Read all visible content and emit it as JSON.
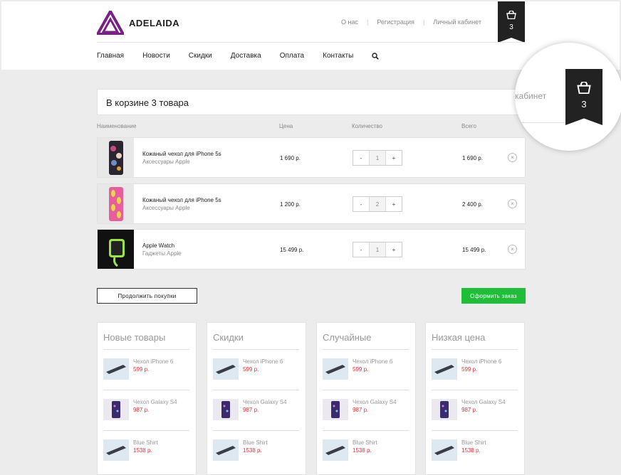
{
  "header": {
    "brand": "ADELAIDA",
    "top_links": [
      "О нас",
      "Регистрация",
      "Личный кабинет"
    ],
    "cart_count": "3",
    "nav": [
      "Главная",
      "Новости",
      "Скидки",
      "Доставка",
      "Оплата",
      "Контакты"
    ]
  },
  "cart": {
    "title": "В корзине 3 товара",
    "columns": {
      "name": "Наименование",
      "price": "Цена",
      "qty": "Количество",
      "total": "Всего"
    },
    "items": [
      {
        "name": "Кожаный чехол для iPhone 5s",
        "category": "Аксессуары Apple",
        "price": "1 690 р.",
        "qty": "1",
        "total": "1 690 р.",
        "thumb": "phone-case-dark"
      },
      {
        "name": "Кожаный чехол для iPhone 5s",
        "category": "Аксессуары Apple",
        "price": "1 200 р.",
        "qty": "2",
        "total": "2 400 р.",
        "thumb": "phone-case-pink"
      },
      {
        "name": "Apple Watch",
        "category": "Гаджеты Apple",
        "price": "15 499 р.",
        "qty": "1",
        "total": "15 499 р.",
        "thumb": "watch-green"
      }
    ],
    "minus": "-",
    "plus": "+",
    "continue_label": "Продолжить покупки",
    "order_label": "Оформить заказ",
    "accent_color": "#1fbd3a"
  },
  "panels": [
    {
      "title": "Новые товары",
      "items": [
        {
          "name": "Чехол iPhone 6",
          "price": "599 р."
        },
        {
          "name": "Чехол Galaxy S4",
          "price": "987 р."
        },
        {
          "name": "Blue Shirt",
          "price": "1538 р."
        }
      ]
    },
    {
      "title": "Скидки",
      "items": [
        {
          "name": "Чехол iPhone 6",
          "price": "599 р."
        },
        {
          "name": "Чехол Galaxy S4",
          "price": "987 р."
        },
        {
          "name": "Blue Shirt",
          "price": "1538 р."
        }
      ]
    },
    {
      "title": "Случайные",
      "items": [
        {
          "name": "Чехол iPhone 6",
          "price": "599 р."
        },
        {
          "name": "Чехол Galaxy S4",
          "price": "987 р."
        },
        {
          "name": "Blue Shirt",
          "price": "1538 р."
        }
      ]
    },
    {
      "title": "Низкая цена",
      "items": [
        {
          "name": "Чехол iPhone 6",
          "price": "599 р."
        },
        {
          "name": "Чехол Galaxy S4",
          "price": "987 р."
        },
        {
          "name": "Blue Shirt",
          "price": "1538 р."
        }
      ]
    }
  ],
  "magnifier": {
    "text": "кабинет",
    "cart_count": "3"
  }
}
